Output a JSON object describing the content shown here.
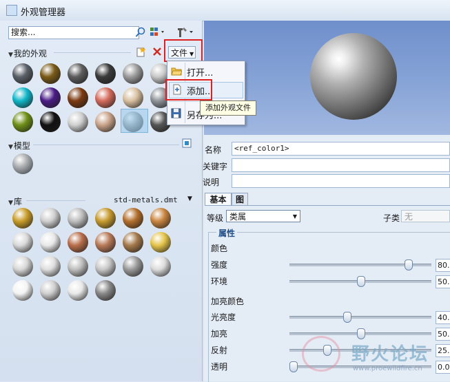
{
  "window": {
    "title": "外观管理器"
  },
  "search": {
    "placeholder": "搜索..."
  },
  "my_appearances": {
    "label": "我的外观",
    "file_button": "文件",
    "swatch_colors": [
      "#5a6068",
      "#7a5a18",
      "#5d5d5d",
      "#3a3a3a",
      "#9b9b9b",
      "#c8c8c8",
      "#10b6c8",
      "#4a1d86",
      "#7b3a12",
      "#d46a5c",
      "#d9c0a0",
      "#8f9499",
      "#6f8f18",
      "#111111",
      "#d0d0d0",
      "#c9a38a",
      "#9aa2a6",
      "#555555"
    ]
  },
  "file_menu": {
    "items": [
      "打开...",
      "添加...",
      "另存为..."
    ],
    "tooltip": "添加外观文件"
  },
  "model": {
    "label": "模型"
  },
  "library": {
    "label": "库",
    "file": "std-metals.dmt",
    "swatch_colors": [
      "#c99d2a",
      "#cfcfcf",
      "#bdbdbd",
      "#c79a2e",
      "#b36f2c",
      "#c9853f",
      "#d9d9d9",
      "#e8e8e8",
      "#b86e4a",
      "#b87a58",
      "#a57a4c",
      "#e5c44a",
      "#d7d7d7",
      "#dedede",
      "#bebebe",
      "#c7c7c7",
      "#9a9a9a",
      "#dcdcdc",
      "#f4f4f4",
      "#cfcfcf",
      "#e9e9e9",
      "#888888"
    ]
  },
  "props": {
    "name_label": "名称",
    "name_value": "<ref_color1>",
    "keyword_label": "关键字",
    "desc_label": "说明",
    "tabs": [
      "基本",
      "图"
    ],
    "level_label": "等级",
    "level_value": "类属",
    "subclass_label": "子类",
    "subclass_value": "无",
    "attributes_label": "属性",
    "color_label": "颜色",
    "highlight_color_label": "加亮颜色",
    "sliders": [
      {
        "label": "强度",
        "value": "80.",
        "level": 0.85
      },
      {
        "label": "环境",
        "value": "50.",
        "level": 0.5
      },
      {
        "label": "光亮度",
        "value": "40.",
        "level": 0.4
      },
      {
        "label": "加亮",
        "value": "50.",
        "level": 0.5
      },
      {
        "label": "反射",
        "value": "25.",
        "level": 0.25
      },
      {
        "label": "透明",
        "value": "0.0",
        "level": 0.0
      }
    ]
  },
  "watermark": {
    "text": "野火论坛",
    "url": "www.proewildfire.cn"
  }
}
